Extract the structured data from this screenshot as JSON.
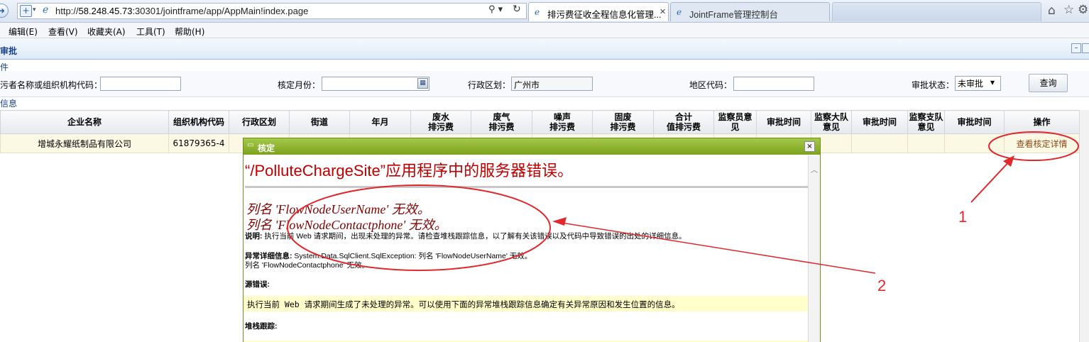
{
  "browser": {
    "url_scheme": "http://",
    "url_host": "58.248.45.73",
    "url_rest": ":30301/jointframe/app/AppMain!index.page",
    "search_glyph": "⚲ ▾",
    "refresh_glyph": "↻",
    "tabs": [
      {
        "label": "排污费征收全程信息化管理...",
        "close": "✕"
      },
      {
        "label": "JointFrame管理控制台"
      }
    ],
    "home_glyph": "⌂",
    "star_glyph": "☆",
    "gear_glyph": "⚙"
  },
  "menu": [
    "编辑(E)",
    "查看(V)",
    "收藏夹(A)",
    "工具(T)",
    "帮助(H)"
  ],
  "page": {
    "title": "审批",
    "search_legend": "件",
    "info_legend": "信息"
  },
  "search": {
    "label_name": "污者名称或组织机构代码：",
    "label_month": "核定月份：",
    "label_region": "行政区划：",
    "region_value": "广州市",
    "label_area_code": "地区代码：",
    "label_status": "审批状态：",
    "status_value": "未审批",
    "button": "查询"
  },
  "grid": {
    "headers": [
      "企业名称",
      "组织机构代码",
      "行政区划",
      "街道",
      "年月",
      "废水\n排污费",
      "废气\n排污费",
      "噪声\n排污费",
      "固废\n排污费",
      "合计\n值排污费",
      "监察员意\n见",
      "审批时间",
      "监察大队\n意见",
      "审批时间",
      "监察支队\n意见",
      "审批时间",
      "操作"
    ],
    "row": {
      "company": "增城永耀纸制品有限公司",
      "org_code": "61879365-4",
      "action": "查看核定详情"
    }
  },
  "modal": {
    "title": "核定",
    "close": "×",
    "error_title": "“/PolluteChargeSite”应用程序中的服务器错误。",
    "error_line1": "列名 'FlowNodeUserName' 无效。",
    "error_line2": "列名 'FlowNodeContactphone' 无效。",
    "desc_label": "说明:",
    "desc_text": "执行当前 Web 请求期间，出现未处理的异常。请检查堆栈跟踪信息，以了解有关该错误以及代码中导致错误的出处的详细信息。",
    "exc_label": "异常详细信息:",
    "exc_text": "System.Data.SqlClient.SqlException: 列名 'FlowNodeUserName' 无效。",
    "exc_text2": "列名 'FlowNodeContactphone' 无效。",
    "source_label": "源错误:",
    "source_text": "执行当前 Web 请求期间生成了未处理的异常。可以使用下面的异常堆栈跟踪信息确定有关异常原因和发生位置的信息。",
    "stack_label": "堆栈跟踪:"
  },
  "annotations": {
    "label1": "1",
    "label2": "2",
    "color": "#e0282d"
  }
}
